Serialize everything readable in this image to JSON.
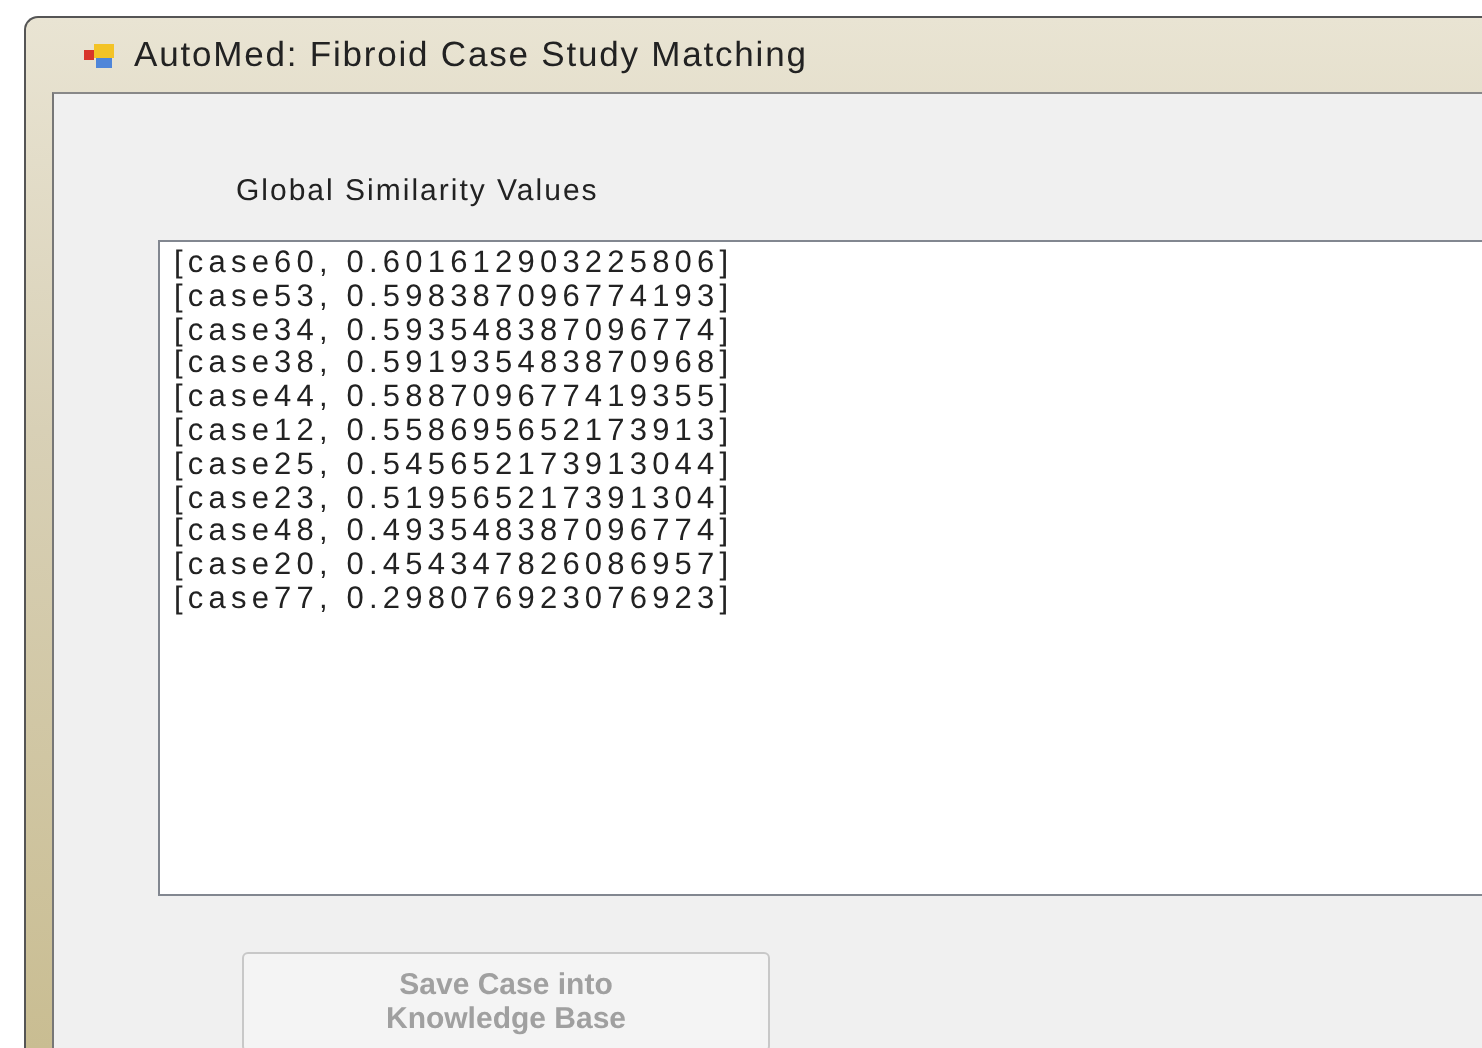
{
  "window": {
    "title": "AutoMed: Fibroid Case Study Matching"
  },
  "label": "Global Similarity Values",
  "list": {
    "items": [
      "[case60, 0.601612903225806]",
      "[case53, 0.598387096774193]",
      "[case34, 0.593548387096774]",
      "[case38, 0.591935483870968]",
      "[case44, 0.588709677419355]",
      "[case12, 0.558695652173913]",
      "[case25, 0.545652173913044]",
      "[case23, 0.519565217391304]",
      "[case48, 0.493548387096774]",
      "[case20, 0.454347826086957]",
      "[case77, 0.298076923076923]"
    ]
  },
  "buttons": [
    {
      "label": "Save Case into Knowledge Base",
      "disabled": true
    }
  ]
}
